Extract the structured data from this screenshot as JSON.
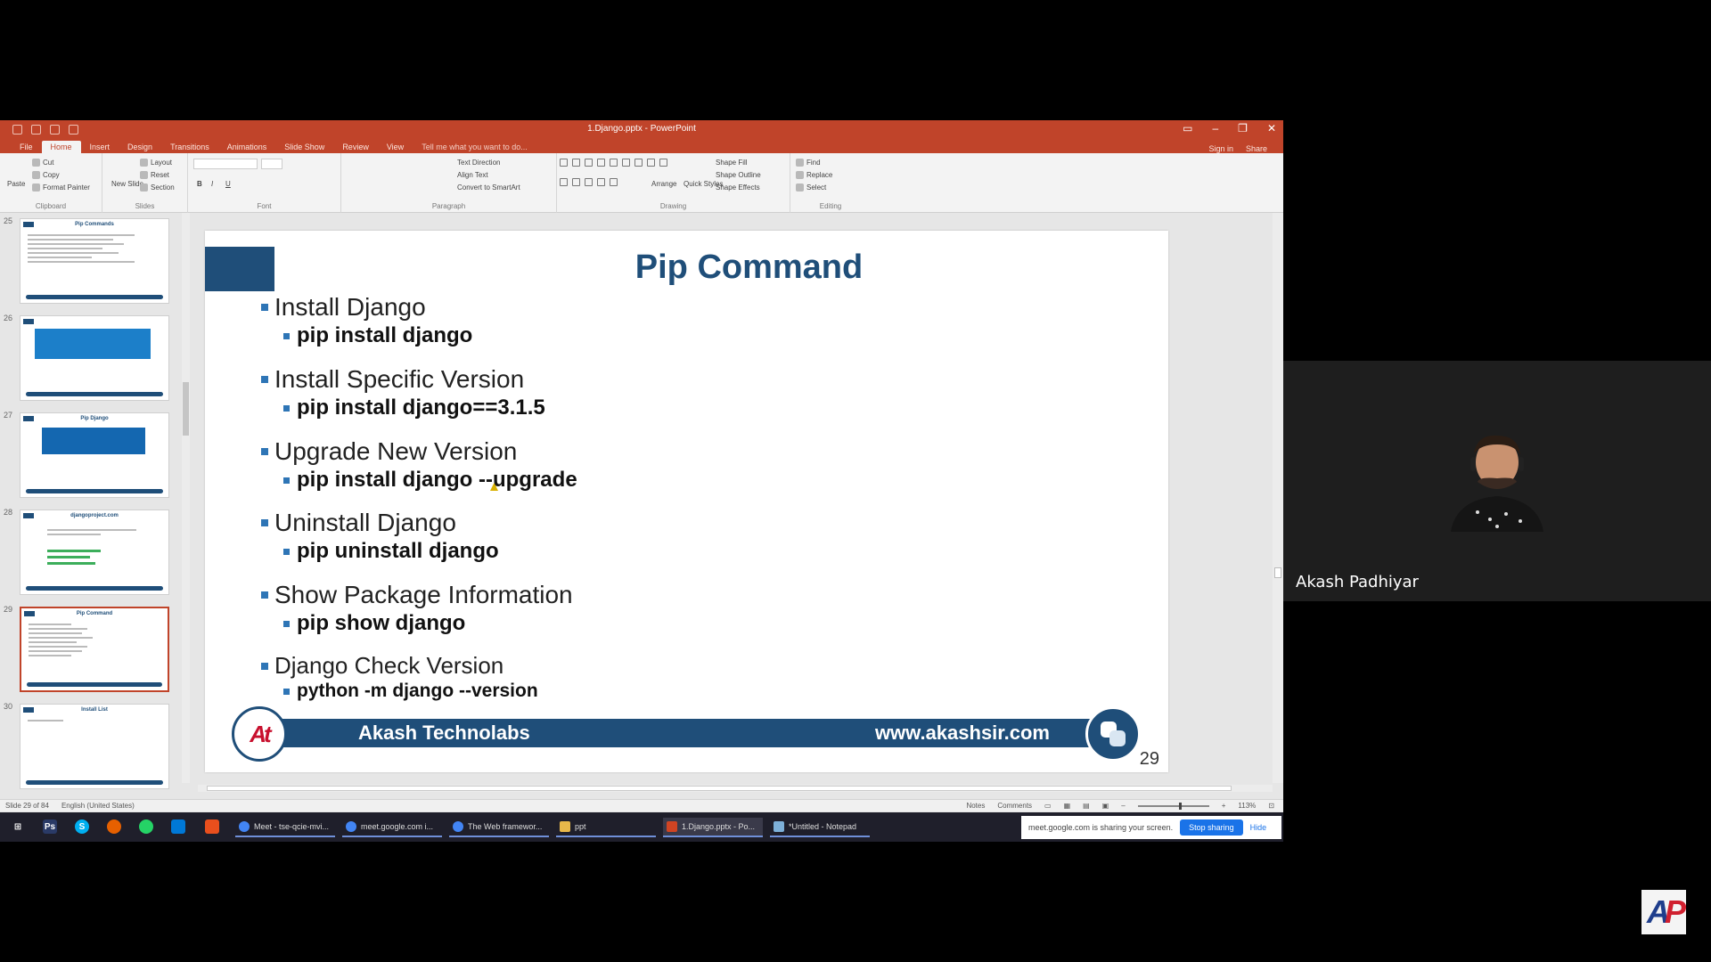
{
  "window": {
    "title": "1.Django.pptx - PowerPoint",
    "tabs": [
      "File",
      "Home",
      "Insert",
      "Design",
      "Transitions",
      "Animations",
      "Slide Show",
      "Review",
      "View"
    ],
    "tell_me": "Tell me what you want to do...",
    "sign_in": "Sign in",
    "share": "Share"
  },
  "ribbon": {
    "clipboard": {
      "label": "Clipboard",
      "paste": "Paste",
      "cut": "Cut",
      "copy": "Copy",
      "format_painter": "Format Painter"
    },
    "slides": {
      "label": "Slides",
      "new_slide": "New Slide",
      "layout": "Layout",
      "reset": "Reset",
      "section": "Section"
    },
    "font": {
      "label": "Font"
    },
    "paragraph": {
      "label": "Paragraph",
      "text_direction": "Text Direction",
      "align_text": "Align Text",
      "convert": "Convert to SmartArt"
    },
    "drawing": {
      "label": "Drawing",
      "arrange": "Arrange",
      "quick_styles": "Quick Styles",
      "shape_fill": "Shape Fill",
      "shape_outline": "Shape Outline",
      "shape_effects": "Shape Effects"
    },
    "editing": {
      "label": "Editing",
      "find": "Find",
      "replace": "Replace",
      "select": "Select"
    }
  },
  "thumbnails": [
    {
      "num": "25",
      "title": "Pip Commands"
    },
    {
      "num": "26",
      "title": ""
    },
    {
      "num": "27",
      "title": "Pip Django"
    },
    {
      "num": "28",
      "title": "djangoproject.com"
    },
    {
      "num": "29",
      "title": "Pip Command"
    },
    {
      "num": "30",
      "title": "Install List"
    }
  ],
  "slide": {
    "title": "Pip Command",
    "items": [
      {
        "heading": "Install Django",
        "command": "pip install django"
      },
      {
        "heading": "Install Specific Version",
        "command": "pip install django==3.1.5"
      },
      {
        "heading": "Upgrade New Version",
        "command": "pip install django --upgrade"
      },
      {
        "heading": "Uninstall Django",
        "command": "pip uninstall django"
      },
      {
        "heading": "Show Package Information",
        "command": "pip show django"
      },
      {
        "heading": "Django Check Version",
        "command": "python -m django --version"
      }
    ],
    "brand": "Akash Technolabs",
    "website": "www.akashsir.com",
    "logo_text": "At",
    "page_number": "29"
  },
  "statusbar": {
    "slide_info": "Slide 29 of 84",
    "language": "English (United States)",
    "notes": "Notes",
    "comments": "Comments",
    "zoom": "113%"
  },
  "taskbar": {
    "apps": [
      {
        "label": "Meet - tse-qcie-mvi...",
        "color": "#4285f4"
      },
      {
        "label": "meet.google.com i...",
        "color": "#4285f4"
      },
      {
        "label": "The Web framewor...",
        "color": "#4285f4"
      },
      {
        "label": "ppt",
        "color": "#e8b84a"
      },
      {
        "label": "1.Django.pptx - Po...",
        "color": "#d04423"
      },
      {
        "label": "*Untitled - Notepad",
        "color": "#7db0d8"
      }
    ],
    "share_notice": "meet.google.com is sharing your screen.",
    "stop_sharing": "Stop sharing",
    "hide": "Hide"
  },
  "participant": {
    "name": "Akash Padhiyar"
  },
  "colors": {
    "ppt_accent": "#c0442a",
    "slide_blue": "#1f4e79",
    "bullet_blue": "#2e75b6"
  }
}
